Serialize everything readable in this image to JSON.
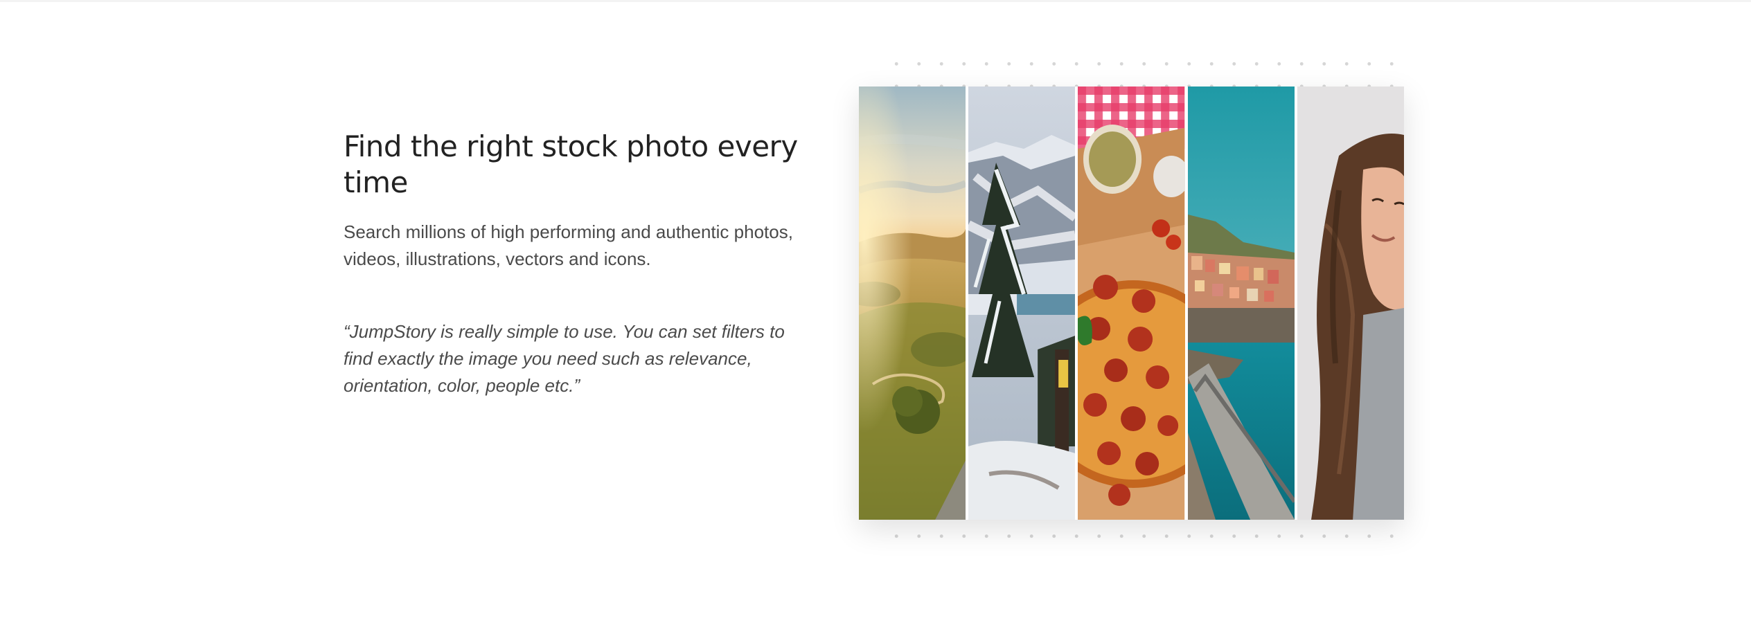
{
  "feature": {
    "headline": "Find the right stock photo every time",
    "description": "Search millions of high performing and authentic photos, videos, illustrations, vectors and icons.",
    "testimonial": "“JumpStory is really simple to use. You can set filters to find exactly the image you need such as relevance, orientation, color, people etc.”"
  },
  "collage": {
    "images": [
      {
        "name": "landscape-sunset-photo"
      },
      {
        "name": "snowy-mountain-photo"
      },
      {
        "name": "pepperoni-pizza-photo"
      },
      {
        "name": "coastal-village-photo"
      },
      {
        "name": "smiling-woman-photo"
      }
    ]
  }
}
